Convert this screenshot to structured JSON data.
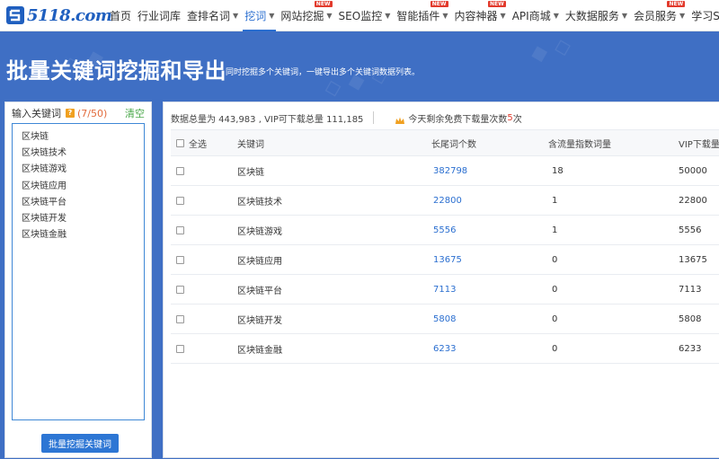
{
  "nav": {
    "logo": "5118.com",
    "items": [
      {
        "label": "首页",
        "caret": false,
        "badge": "",
        "active": false
      },
      {
        "label": "行业词库",
        "caret": false,
        "badge": "",
        "active": false
      },
      {
        "label": "查排名词",
        "caret": true,
        "badge": "",
        "active": false
      },
      {
        "label": "挖词",
        "caret": true,
        "badge": "",
        "active": true
      },
      {
        "label": "网站挖掘",
        "caret": true,
        "badge": "NEW",
        "active": false
      },
      {
        "label": "SEO监控",
        "caret": true,
        "badge": "",
        "active": false
      },
      {
        "label": "智能插件",
        "caret": true,
        "badge": "NEW",
        "active": false
      },
      {
        "label": "内容神器",
        "caret": true,
        "badge": "NEW",
        "active": false
      },
      {
        "label": "API商城",
        "caret": true,
        "badge": "",
        "active": false
      },
      {
        "label": "大数据服务",
        "caret": true,
        "badge": "",
        "active": false
      },
      {
        "label": "会员服务",
        "caret": true,
        "badge": "NEW",
        "active": false
      },
      {
        "label": "学习SEO",
        "caret": true,
        "badge": "",
        "active": false
      }
    ]
  },
  "hero": {
    "title": "批量关键词挖掘和导出",
    "desc": "同时挖掘多个关键词，一键导出多个关键词数据列表。"
  },
  "left": {
    "label": "输入关键词",
    "help_icon": "?",
    "count": "(7/50)",
    "clear": "清空",
    "keywords": [
      "区块链",
      "区块链技术",
      "区块链游戏",
      "区块链应用",
      "区块链平台",
      "区块链开发",
      "区块链金融"
    ],
    "button": "批量挖掘关键词"
  },
  "right": {
    "stats_prefix": "数据总量为 443,983 , VIP可下载总量 111,185",
    "free_text": "今天剩余免费下载量次数",
    "free_count": "5",
    "free_suffix": "次",
    "headers": {
      "select_all": "全选",
      "keyword": "关键词",
      "long_tail": "长尾词个数",
      "flow_index": "含流量指数词量",
      "vip_download": "VIP下载量"
    },
    "rows": [
      {
        "keyword": "区块链",
        "long_tail": "382798",
        "flow_index": "18",
        "vip_download": "50000"
      },
      {
        "keyword": "区块链技术",
        "long_tail": "22800",
        "flow_index": "1",
        "vip_download": "22800"
      },
      {
        "keyword": "区块链游戏",
        "long_tail": "5556",
        "flow_index": "1",
        "vip_download": "5556"
      },
      {
        "keyword": "区块链应用",
        "long_tail": "13675",
        "flow_index": "0",
        "vip_download": "13675"
      },
      {
        "keyword": "区块链平台",
        "long_tail": "7113",
        "flow_index": "0",
        "vip_download": "7113"
      },
      {
        "keyword": "区块链开发",
        "long_tail": "5808",
        "flow_index": "0",
        "vip_download": "5808"
      },
      {
        "keyword": "区块链金融",
        "long_tail": "6233",
        "flow_index": "0",
        "vip_download": "6233"
      }
    ]
  },
  "colors": {
    "brand_blue": "#2b6fd0",
    "hero_bg": "#3f6fc4",
    "badge_red": "#e23a2c",
    "clear_green": "#4aa84a"
  }
}
